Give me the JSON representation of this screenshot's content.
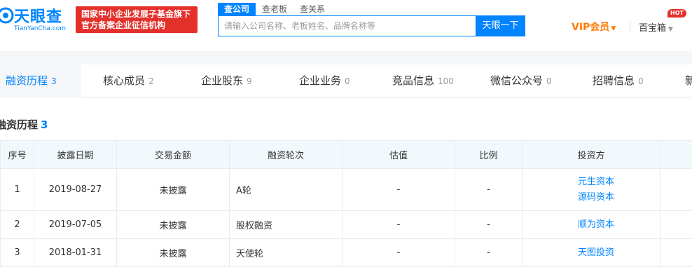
{
  "header": {
    "logo_cn": "天眼查",
    "logo_en": "TianYanCha.com",
    "slogan_line1": "国家中小企业发展子基金旗下",
    "slogan_line2": "官方备案企业征信机构",
    "search_tabs": [
      "查公司",
      "查老板",
      "查关系"
    ],
    "search_placeholder": "请输入公司名称、老板姓名、品牌名称等",
    "search_button": "天眼一下",
    "vip_label": "VIP会员",
    "treasure_label": "百宝箱",
    "hot_badge": "HOT",
    "brand_color": "#0084ff",
    "accent_color": "#e3302b"
  },
  "nav": {
    "tabs": [
      {
        "label": "融资历程",
        "count": "3"
      },
      {
        "label": "核心成员",
        "count": "2"
      },
      {
        "label": "企业股东",
        "count": "9"
      },
      {
        "label": "企业业务",
        "count": "0"
      },
      {
        "label": "竞品信息",
        "count": "100"
      },
      {
        "label": "微信公众号",
        "count": "0"
      },
      {
        "label": "招聘信息",
        "count": "0"
      },
      {
        "label": "新",
        "count": ""
      }
    ]
  },
  "section": {
    "title": "融资历程",
    "count": "3"
  },
  "table": {
    "headers": [
      "序号",
      "披露日期",
      "交易金额",
      "融资轮次",
      "估值",
      "比例",
      "投资方"
    ],
    "rows": [
      {
        "no": "1",
        "date": "2019-08-27",
        "amount": "未披露",
        "round": "A轮",
        "valuation": "-",
        "ratio": "-",
        "investors": [
          "元生资本",
          "源码资本"
        ]
      },
      {
        "no": "2",
        "date": "2019-07-05",
        "amount": "未披露",
        "round": "股权融资",
        "valuation": "-",
        "ratio": "-",
        "investors": [
          "顺为资本"
        ]
      },
      {
        "no": "3",
        "date": "2018-01-31",
        "amount": "未披露",
        "round": "天使轮",
        "valuation": "-",
        "ratio": "-",
        "investors": [
          "天图投资"
        ]
      }
    ]
  }
}
